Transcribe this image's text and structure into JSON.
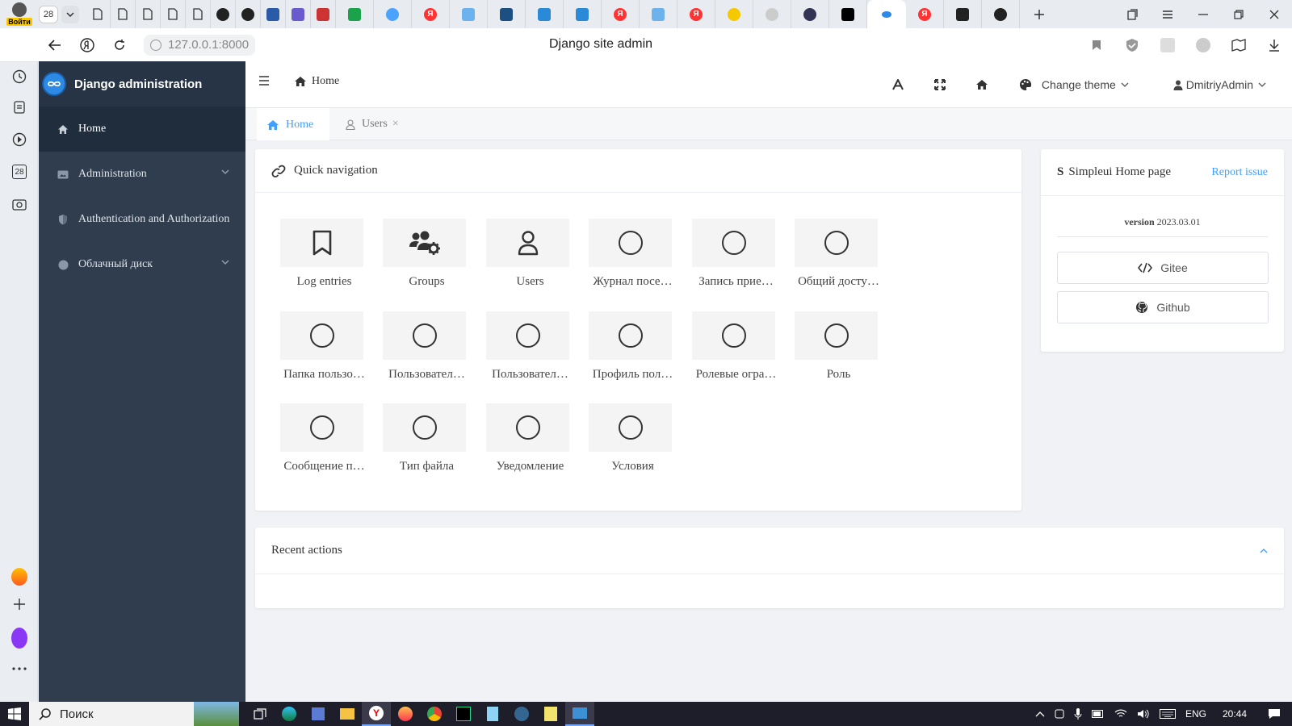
{
  "browser": {
    "profile_label": "Войти",
    "tab_count": "28",
    "url": "127.0.0.1:8000",
    "page_title": "Django site admin"
  },
  "rail": {
    "calendar_day": "28"
  },
  "sidebar": {
    "brand": "Django administration",
    "items": [
      {
        "label": "Home",
        "icon": "home-icon"
      },
      {
        "label": "Administration",
        "icon": "admin-card-icon"
      },
      {
        "label": "Authentication and Authorization",
        "icon": "shield-icon"
      },
      {
        "label": "Облачный диск",
        "icon": "circle-icon"
      }
    ]
  },
  "header": {
    "breadcrumb": "Home",
    "change_theme": "Change theme",
    "user": "DmitriyAdmin"
  },
  "page_tabs": [
    {
      "label": "Home"
    },
    {
      "label": "Users"
    }
  ],
  "quick_nav": {
    "title": "Quick navigation",
    "tiles": [
      {
        "label": "Log entries",
        "icon": "bookmark-icon"
      },
      {
        "label": "Groups",
        "icon": "users-cog-icon"
      },
      {
        "label": "Users",
        "icon": "user-icon"
      },
      {
        "label": "Журнал посе…",
        "icon": "circle-icon"
      },
      {
        "label": "Запись прие…",
        "icon": "circle-icon"
      },
      {
        "label": "Общий досту…",
        "icon": "circle-icon"
      },
      {
        "label": "Папка пользо…",
        "icon": "circle-icon"
      },
      {
        "label": "Пользовател…",
        "icon": "circle-icon"
      },
      {
        "label": "Пользовател…",
        "icon": "circle-icon"
      },
      {
        "label": "Профиль пол…",
        "icon": "circle-icon"
      },
      {
        "label": "Ролевые огра…",
        "icon": "circle-icon"
      },
      {
        "label": "Роль",
        "icon": "circle-icon"
      },
      {
        "label": "Сообщение п…",
        "icon": "circle-icon"
      },
      {
        "label": "Тип файла",
        "icon": "circle-icon"
      },
      {
        "label": "Уведомление",
        "icon": "circle-icon"
      },
      {
        "label": "Условия",
        "icon": "circle-icon"
      }
    ]
  },
  "simpleui": {
    "title": "Simpleui Home page",
    "report": "Report issue",
    "version_label": "version",
    "version": "2023.03.01",
    "gitee": "Gitee",
    "github": "Github"
  },
  "recent": {
    "title": "Recent actions"
  },
  "taskbar": {
    "search": "Поиск",
    "lang": "ENG",
    "time": "20:44"
  },
  "colors": {
    "sidebar": "#2f3d4f",
    "accent": "#409eff"
  }
}
